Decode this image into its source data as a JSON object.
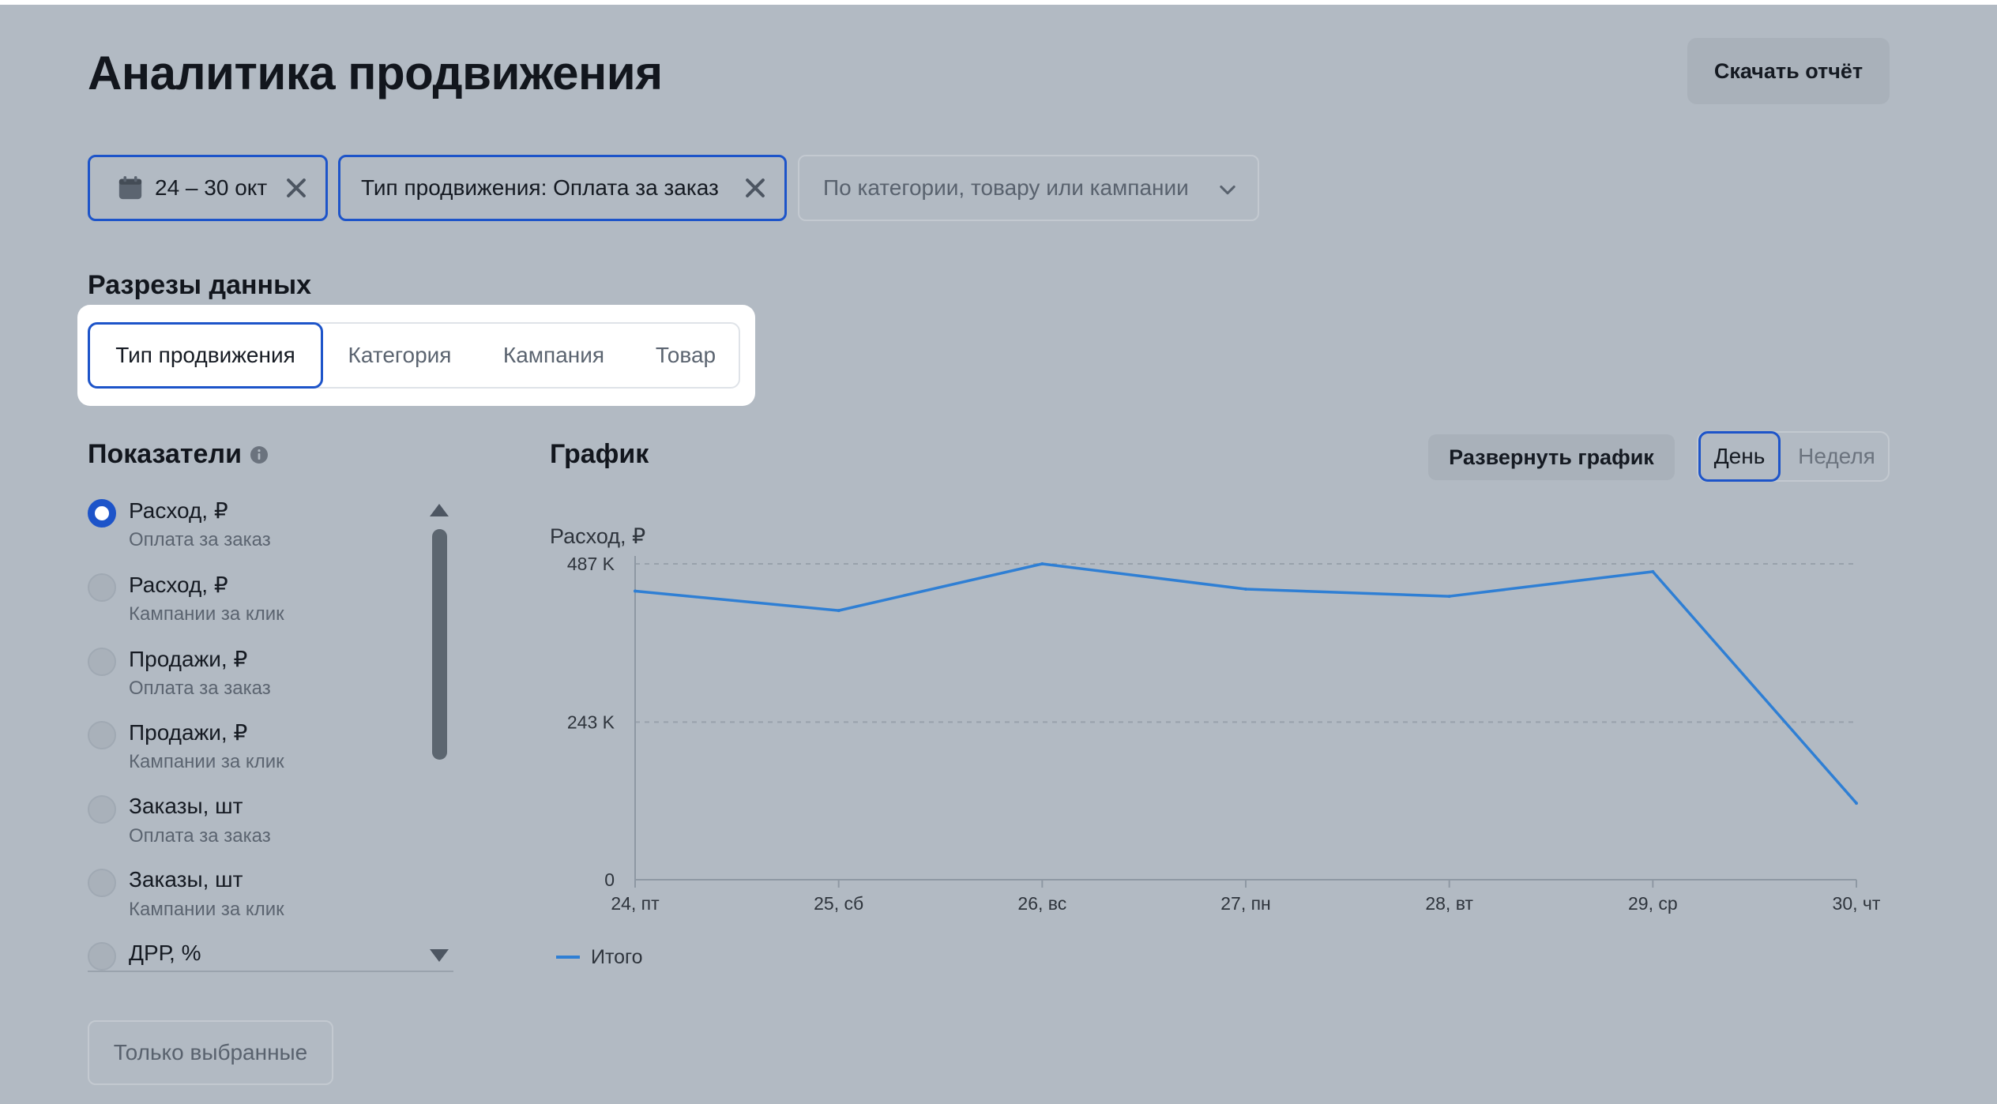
{
  "header": {
    "title": "Аналитика продвижения",
    "download_label": "Скачать отчёт"
  },
  "filters": {
    "date_label": "24 – 30 окт",
    "type_label": "Тип продвижения: Оплата за заказ",
    "select_placeholder": "По категории, товару или кампании"
  },
  "slices": {
    "title": "Разрезы данных",
    "tabs": [
      {
        "label": "Тип продвижения",
        "active": true
      },
      {
        "label": "Категория",
        "active": false
      },
      {
        "label": "Кампания",
        "active": false
      },
      {
        "label": "Товар",
        "active": false
      }
    ]
  },
  "metrics": {
    "title": "Показатели",
    "items": [
      {
        "name": "Расход, ₽",
        "sub": "Оплата за заказ",
        "checked": true
      },
      {
        "name": "Расход, ₽",
        "sub": "Кампании за клик",
        "checked": false
      },
      {
        "name": "Продажи, ₽",
        "sub": "Оплата за заказ",
        "checked": false
      },
      {
        "name": "Продажи, ₽",
        "sub": "Кампании за клик",
        "checked": false
      },
      {
        "name": "Заказы, шт",
        "sub": "Оплата за заказ",
        "checked": false
      },
      {
        "name": "Заказы, шт",
        "sub": "Кампании за клик",
        "checked": false
      },
      {
        "name": "ДРР, %",
        "sub": "",
        "checked": false
      }
    ],
    "only_selected_label": "Только выбранные"
  },
  "chart_panel": {
    "title": "График",
    "expand_label": "Развернуть график",
    "period_options": {
      "day": "День",
      "week": "Неделя",
      "selected": "day"
    }
  },
  "colors": {
    "accent": "#1d54c9",
    "line": "#2f7fd4",
    "background": "#b2bac3"
  },
  "chart_data": {
    "type": "line",
    "ylabel": "Расход, ₽",
    "y_ticks": [
      {
        "value": 0,
        "label": "0"
      },
      {
        "value": 243000,
        "label": "243 K"
      },
      {
        "value": 487000,
        "label": "487 K"
      }
    ],
    "ylim": [
      0,
      487000
    ],
    "categories": [
      "24, пт",
      "25, сб",
      "26, вс",
      "27, пн",
      "28, вт",
      "29, ср",
      "30, чт"
    ],
    "series": [
      {
        "name": "Итого",
        "values": [
          445000,
          415000,
          487000,
          448000,
          437000,
          475000,
          118000
        ]
      }
    ],
    "grid": true,
    "legend": "bottom-left"
  }
}
